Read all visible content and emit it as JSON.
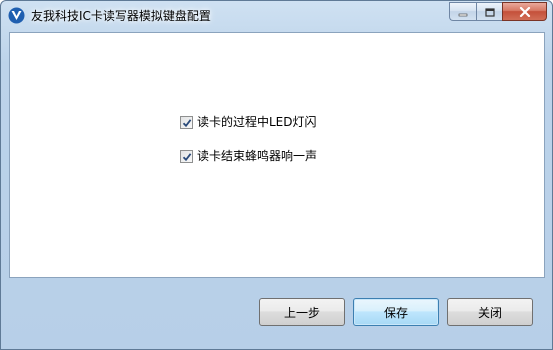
{
  "window": {
    "title": "友我科技IC卡读写器模拟键盘配置"
  },
  "icons": {
    "app": "app-logo-icon",
    "minimize": "minimize-icon",
    "maximize": "maximize-icon",
    "close": "close-icon",
    "checkmark": "checkmark-icon"
  },
  "options": [
    {
      "label": "读卡的过程中LED灯闪",
      "checked": true
    },
    {
      "label": "读卡结束蜂鸣器响一声",
      "checked": true
    }
  ],
  "buttons": {
    "prev": "上一步",
    "save": "保存",
    "close": "关闭"
  },
  "colors": {
    "titlebar": "#b9d1ea",
    "close_button": "#c75050",
    "default_button_border": "#3c7fb1",
    "checkmark": "#2a4a7a"
  }
}
